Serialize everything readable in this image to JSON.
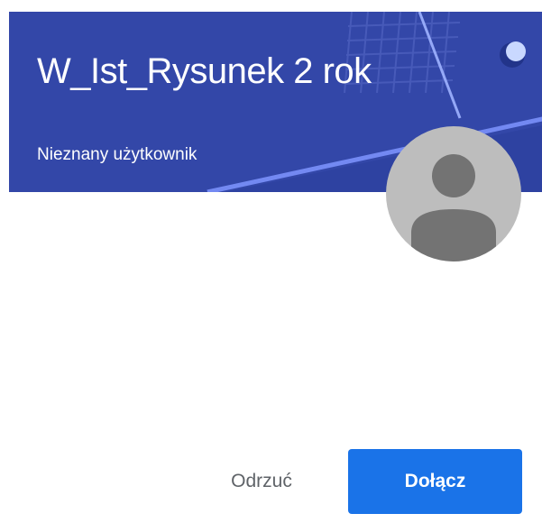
{
  "card": {
    "class_title": "W_Ist_Rysunek 2 rok",
    "owner_name": "Nieznany użytkownik"
  },
  "actions": {
    "decline_label": "Odrzuć",
    "join_label": "Dołącz"
  },
  "colors": {
    "banner": "#3347a8",
    "banner_accent": "#4a5dbb",
    "join_button": "#1a73e8",
    "decline_text": "#5f6368",
    "avatar_bg": "#bdbdbd",
    "avatar_figure": "#737373"
  },
  "icons": {
    "avatar": "account-circle-icon",
    "banner_decoration": "notebook-grid-illustration"
  }
}
